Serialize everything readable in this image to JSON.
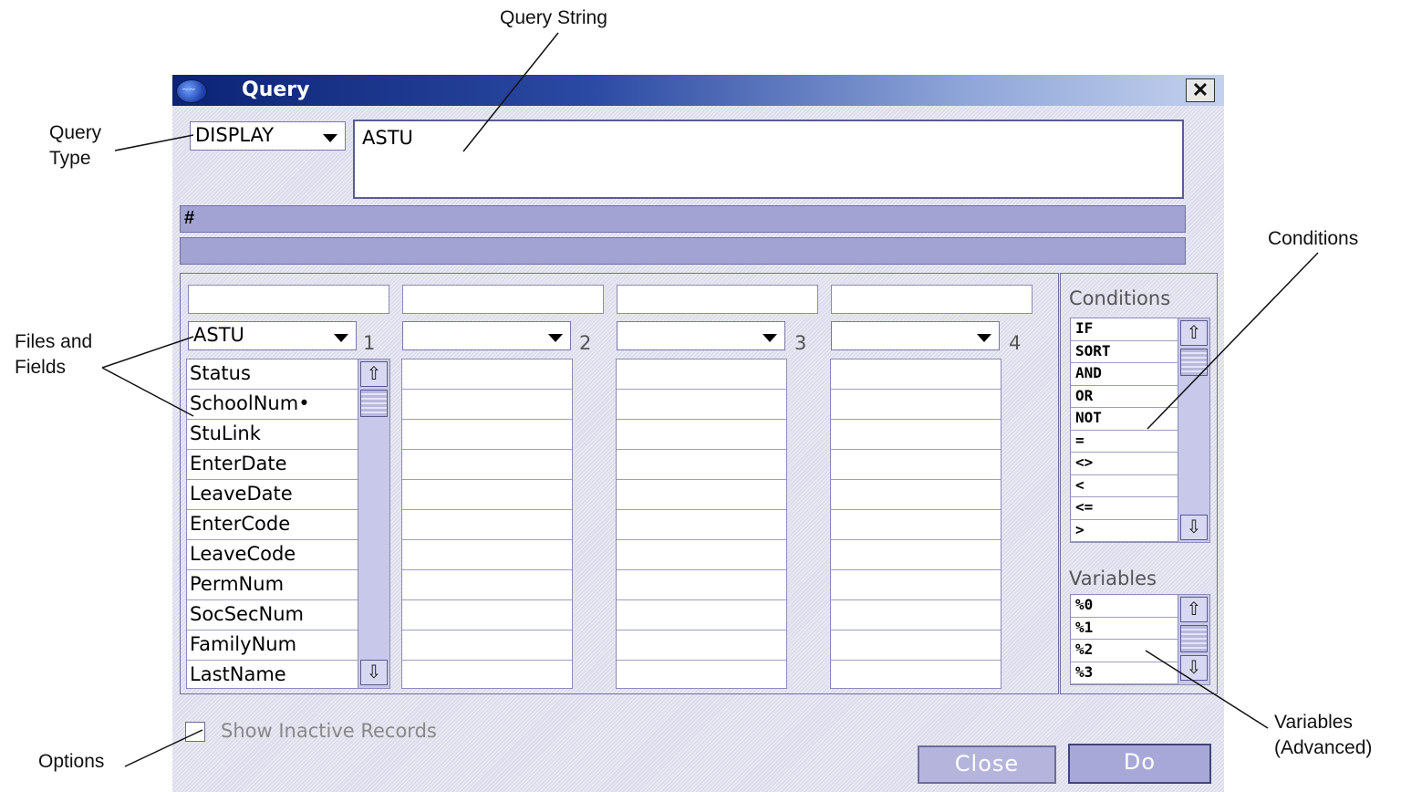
{
  "annotations": {
    "query_string": "Query String",
    "query_type": [
      "Query",
      "Type"
    ],
    "files_and_fields": [
      "Files and",
      "Fields"
    ],
    "conditions": "Conditions",
    "options": "Options",
    "variables_advanced": [
      "Variables",
      "(Advanced)"
    ]
  },
  "window": {
    "title": "Query",
    "close_glyph": "✕",
    "logo_text": "~~"
  },
  "query": {
    "type_value": "DISPLAY",
    "string_value": "ASTU",
    "bar_label": "#"
  },
  "columns": [
    {
      "number": "1",
      "file": "ASTU",
      "filter": "",
      "fields": [
        "Status",
        "SchoolNum•",
        "StuLink",
        "EnterDate",
        "LeaveDate",
        "EnterCode",
        "LeaveCode",
        "PermNum",
        "SocSecNum",
        "FamilyNum",
        "LastName"
      ]
    },
    {
      "number": "2",
      "file": "",
      "filter": "",
      "fields": []
    },
    {
      "number": "3",
      "file": "",
      "filter": "",
      "fields": []
    },
    {
      "number": "4",
      "file": "",
      "filter": "",
      "fields": []
    }
  ],
  "conditions": {
    "label": "Conditions",
    "items": [
      "IF",
      "SORT",
      "AND",
      "OR",
      "NOT",
      "=",
      "<>",
      "<",
      "<=",
      ">"
    ]
  },
  "variables": {
    "label": "Variables",
    "items": [
      "%0",
      "%1",
      "%2",
      "%3"
    ]
  },
  "scroll_glyphs": {
    "up": "⇧",
    "down": "⇩"
  },
  "options": {
    "show_inactive_label": "Show Inactive Records",
    "show_inactive_checked": false
  },
  "buttons": {
    "close_label": "Close",
    "do_label": "Do"
  }
}
